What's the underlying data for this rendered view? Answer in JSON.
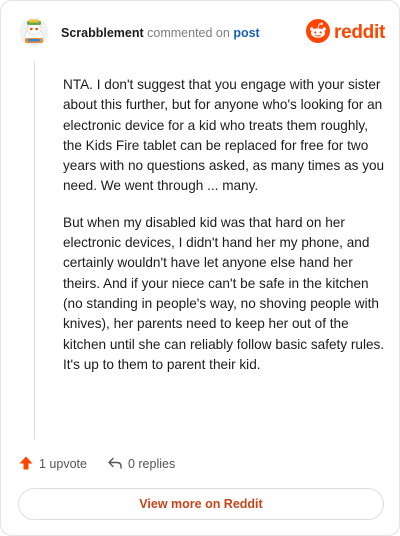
{
  "comment": {
    "author": "Scrabblement",
    "action_text": "commented on",
    "post_link": "post",
    "paragraphs": [
      "NTA. I don't suggest that you engage with your sister about this further, but for anyone who's looking for an electronic device for a kid who treats them roughly, the Kids Fire tablet can be replaced for free for two years with no questions asked, as many times as you need. We went through ... many.",
      "But when my disabled kid was that hard on her electronic devices, I didn't hand her my phone, and certainly wouldn't have let anyone else hand her theirs. And if your niece can't be safe in the kitchen (no standing in people's way, no shoving people with knives), her parents need to keep her out of the kitchen until she can reliably follow basic safety rules. It's up to them to parent their kid."
    ],
    "upvotes": "1 upvote",
    "replies": "0 replies"
  },
  "brand": {
    "name": "reddit",
    "color": "#ff4500"
  },
  "footer": {
    "view_more_label": "View more on Reddit"
  },
  "icons": {
    "avatar": "snoo-avatar-icon",
    "logo": "reddit-logo-icon",
    "upvote": "upvote-arrow-icon",
    "reply": "reply-arrow-icon"
  }
}
